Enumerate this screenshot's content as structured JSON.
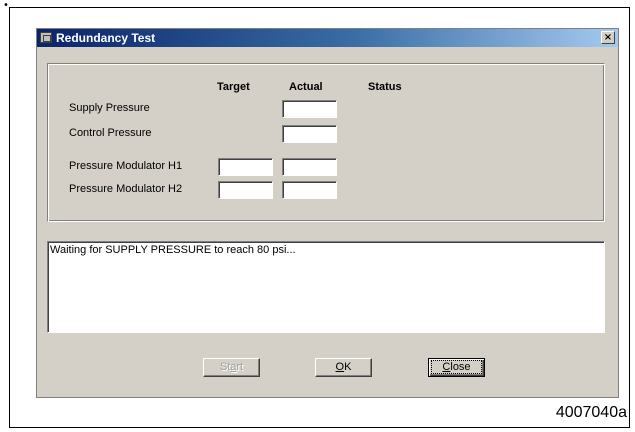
{
  "dialog": {
    "title": "Redundancy Test",
    "close_glyph": "×"
  },
  "columns": {
    "target": "Target",
    "actual": "Actual",
    "status": "Status"
  },
  "rows": [
    {
      "label": "Supply Pressure",
      "has_target": false,
      "target": "",
      "actual": ""
    },
    {
      "label": "Control Pressure",
      "has_target": false,
      "target": "",
      "actual": ""
    },
    {
      "label": "Pressure Modulator H1",
      "has_target": true,
      "target": "",
      "actual": ""
    },
    {
      "label": "Pressure Modulator H2",
      "has_target": true,
      "target": "",
      "actual": ""
    }
  ],
  "log": {
    "text": "Waiting for SUPPLY PRESSURE to reach 80 psi..."
  },
  "buttons": {
    "start": {
      "pre": "St",
      "accel": "a",
      "post": "rt",
      "enabled": false
    },
    "ok": {
      "pre": "",
      "accel": "O",
      "post": "K",
      "enabled": true
    },
    "close": {
      "pre": "",
      "accel": "C",
      "post": "lose",
      "enabled": true,
      "default": true
    }
  },
  "figure_id": "4007040a",
  "corner_mark": "•"
}
